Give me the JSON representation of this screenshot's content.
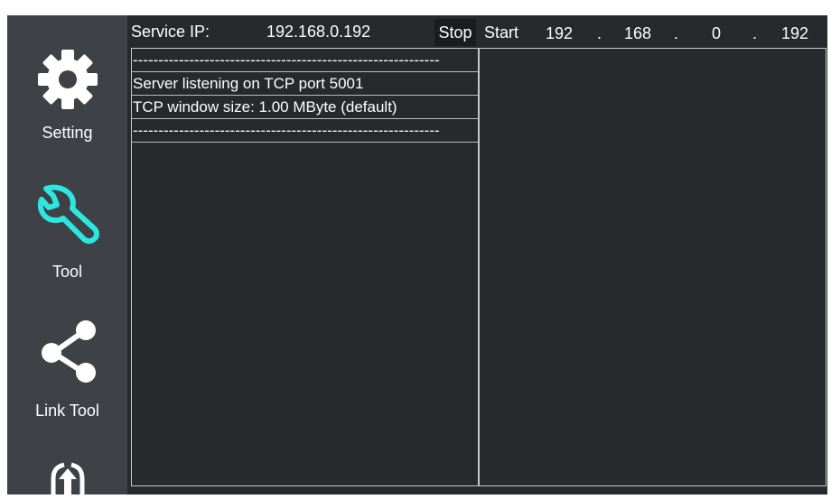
{
  "sidebar": {
    "items": [
      {
        "label": "Setting",
        "icon": "gear-icon",
        "color": "#ffffff"
      },
      {
        "label": "Tool",
        "icon": "wrench-icon",
        "color": "#2ee6e0"
      },
      {
        "label": "Link Tool",
        "icon": "share-icon",
        "color": "#ffffff"
      },
      {
        "label": "",
        "icon": "upload-icon",
        "color": "#ffffff"
      }
    ]
  },
  "topbar": {
    "service_ip_label": "Service IP:",
    "service_ip_value": "192.168.0.192",
    "stop_label": "Stop",
    "start_label": "Start",
    "ip_octets": [
      "192",
      "168",
      "0",
      "192"
    ],
    "ip_separator": "."
  },
  "log": {
    "lines": [
      "------------------------------------------------------------",
      "Server listening on TCP port 5001",
      "TCP window size: 1.00 MByte (default)",
      "------------------------------------------------------------"
    ]
  },
  "colors": {
    "background": "#27292c",
    "sidebar": "#3e4247",
    "accent": "#2ee6e0"
  }
}
